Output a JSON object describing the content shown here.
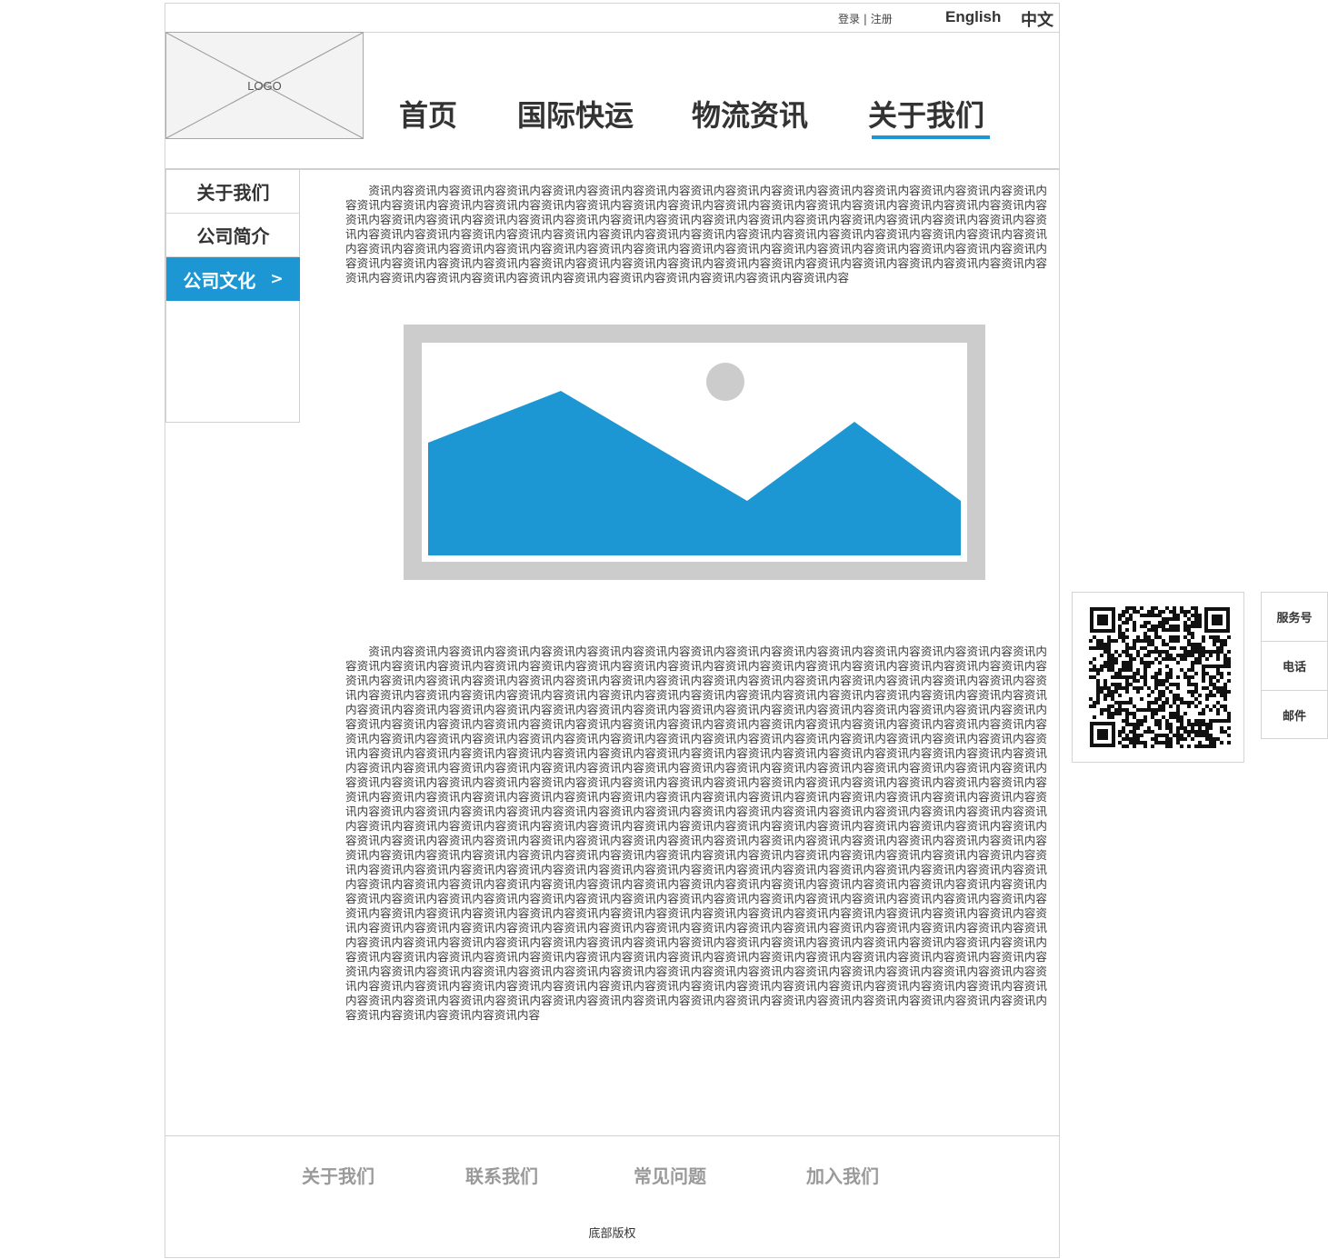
{
  "topbar": {
    "login": "登录",
    "separator": " | ",
    "register": "注册",
    "lang_en": "English",
    "lang_zh": "中文"
  },
  "logo": {
    "text": "LOGO"
  },
  "nav": {
    "items": [
      "首页",
      "国际快运",
      "物流资讯",
      "关于我们"
    ],
    "active_index": 3,
    "accent_color": "#1c97d3"
  },
  "sidebar": {
    "items": [
      "关于我们",
      "公司简介",
      "公司文化"
    ],
    "active_index": 2,
    "active_arrow": ">"
  },
  "content": {
    "para1": "资讯内容资讯内容资讯内容资讯内容资讯内容资讯内容资讯内容资讯内容资讯内容资讯内容资讯内容资讯内容资讯内容资讯内容资讯内容资讯内容资讯内容资讯内容资讯内容资讯内容资讯内容资讯内容资讯内容资讯内容资讯内容资讯内容资讯内容资讯内容资讯内容资讯内容资讯内容资讯内容资讯内容资讯内容资讯内容资讯内容资讯内容资讯内容资讯内容资讯内容资讯内容资讯内容资讯内容资讯内容资讯内容资讯内容资讯内容资讯内容资讯内容资讯内容资讯内容资讯内容资讯内容资讯内容资讯内容资讯内容资讯内容资讯内容资讯内容资讯内容资讯内容资讯内容资讯内容资讯内容资讯内容资讯内容资讯内容资讯内容资讯内容资讯内容资讯内容资讯内容资讯内容资讯内容资讯内容资讯内容资讯内容资讯内容资讯内容资讯内容资讯内容资讯内容资讯内容资讯内容资讯内容资讯内容资讯内容资讯内容资讯内容资讯内容资讯内容资讯内容资讯内容资讯内容资讯内容资讯内容资讯内容资讯内容资讯内容资讯内容资讯内容资讯内容",
    "para2": "资讯内容资讯内容资讯内容资讯内容资讯内容资讯内容资讯内容资讯内容资讯内容资讯内容资讯内容资讯内容资讯内容资讯内容资讯内容资讯内容资讯内容资讯内容资讯内容资讯内容资讯内容资讯内容资讯内容资讯内容资讯内容资讯内容资讯内容资讯内容资讯内容资讯内容资讯内容资讯内容资讯内容资讯内容资讯内容资讯内容资讯内容资讯内容资讯内容资讯内容资讯内容资讯内容资讯内容资讯内容资讯内容资讯内容资讯内容资讯内容资讯内容资讯内容资讯内容资讯内容资讯内容资讯内容资讯内容资讯内容资讯内容资讯内容资讯内容资讯内容资讯内容资讯内容资讯内容资讯内容资讯内容资讯内容资讯内容资讯内容资讯内容资讯内容资讯内容资讯内容资讯内容资讯内容资讯内容资讯内容资讯内容资讯内容资讯内容资讯内容资讯内容资讯内容资讯内容资讯内容资讯内容资讯内容资讯内容资讯内容资讯内容资讯内容资讯内容资讯内容资讯内容资讯内容资讯内容资讯内容资讯内容资讯内容资讯内容资讯内容资讯内容资讯内容资讯内容资讯内容资讯内容资讯内容资讯内容资讯内容资讯内容资讯内容资讯内容资讯内容资讯内容资讯内容资讯内容资讯内容资讯内容资讯内容资讯内容资讯内容资讯内容资讯内容资讯内容资讯内容资讯内容资讯内容资讯内容资讯内容资讯内容资讯内容资讯内容资讯内容资讯内容资讯内容资讯内容资讯内容资讯内容资讯内容资讯内容资讯内容资讯内容资讯内容资讯内容资讯内容资讯内容资讯内容资讯内容资讯内容资讯内容资讯内容资讯内容资讯内容资讯内容资讯内容资讯内容资讯内容资讯内容资讯内容资讯内容资讯内容资讯内容资讯内容资讯内容资讯内容资讯内容资讯内容资讯内容资讯内容资讯内容资讯内容资讯内容资讯内容资讯内容资讯内容资讯内容资讯内容资讯内容资讯内容资讯内容资讯内容资讯内容资讯内容资讯内容资讯内容资讯内容资讯内容资讯内容资讯内容资讯内容资讯内容资讯内容资讯内容资讯内容资讯内容资讯内容资讯内容资讯内容资讯内容资讯内容资讯内容资讯内容资讯内容资讯内容资讯内容资讯内容资讯内容资讯内容资讯内容资讯内容资讯内容资讯内容资讯内容资讯内容资讯内容资讯内容资讯内容资讯内容资讯内容资讯内容资讯内容资讯内容资讯内容资讯内容资讯内容资讯内容资讯内容资讯内容资讯内容资讯内容资讯内容资讯内容资讯内容资讯内容资讯内容资讯内容资讯内容资讯内容资讯内容资讯内容资讯内容资讯内容资讯内容资讯内容资讯内容资讯内容资讯内容资讯内容资讯内容资讯内容资讯内容资讯内容资讯内容资讯内容资讯内容资讯内容资讯内容资讯内容资讯内容资讯内容资讯内容资讯内容资讯内容资讯内容资讯内容资讯内容资讯内容资讯内容资讯内容资讯内容资讯内容资讯内容资讯内容资讯内容资讯内容资讯内容资讯内容资讯内容资讯内容资讯内容资讯内容资讯内容资讯内容资讯内容资讯内容资讯内容资讯内容资讯内容资讯内容资讯内容资讯内容资讯内容资讯内容资讯内容资讯内容资讯内容资讯内容资讯内容资讯内容资讯内容资讯内容资讯内容资讯内容资讯内容资讯内容资讯内容资讯内容资讯内容资讯内容资讯内容资讯内容资讯内容资讯内容资讯内容资讯内容资讯内容资讯内容资讯内容资讯内容资讯内容资讯内容资讯内容资讯内容资讯内容资讯内容资讯内容资讯内容资讯内容资讯内容资讯内容资讯内容资讯内容资讯内容资讯内容资讯内容资讯内容资讯内容资讯内容资讯内容资讯内容资讯内容资讯内容资讯内容资讯内容资讯内容资讯内容资讯内容资讯内容资讯内容资讯内容资讯内容资讯内容资讯内容资讯内容资讯内容资讯内容资讯内容资讯内容资讯内容资讯内容资讯内容资讯内容资讯内容资讯内容资讯内容资讯内容资讯内容资讯内容资讯内容资讯内容资讯内容资讯内容资讯内容资讯内容资讯内容资讯内容资讯内容资讯内容资讯内容资讯内容资讯内容资讯内容资讯内容资讯内容资讯内容资讯内容",
    "image_placeholder": {
      "mountain_color": "#1c97d3",
      "frame_color": "#cccccc",
      "sun_color": "#cccccc"
    }
  },
  "footer": {
    "links": [
      "关于我们",
      "联系我们",
      "常见问题",
      "加入我们"
    ],
    "copyright": "底部版权"
  },
  "side_widgets": {
    "qr_icon": "qr-code",
    "service_items": [
      "服务号",
      "电话",
      "邮件"
    ]
  }
}
